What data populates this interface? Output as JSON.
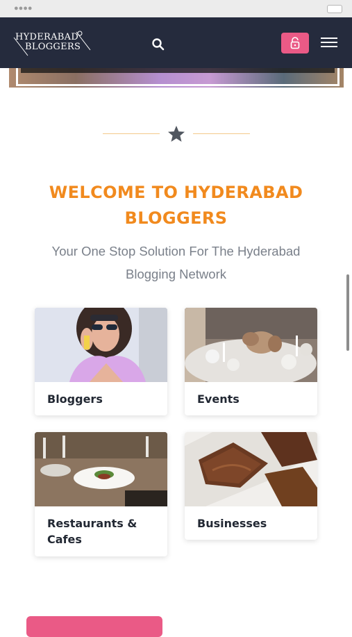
{
  "brand": {
    "logo_line1": "HYDERABAD",
    "logo_line2": "BLOGGERS",
    "accent": "#f18a1e",
    "pink": "#ea5a86",
    "navy": "#252b3d"
  },
  "header": {
    "search_icon": "search-icon",
    "login_icon": "lock-open-icon",
    "menu_icon": "hamburger-menu-icon"
  },
  "divider": {
    "icon": "star-icon"
  },
  "welcome": {
    "title": "WELCOME TO HYDERABAD BLOGGERS",
    "subtitle": "Your One Stop Solution For The Hyderabad Blogging Network"
  },
  "categories": [
    {
      "label": "Bloggers",
      "image": "woman-in-sunglasses-photo"
    },
    {
      "label": "Events",
      "image": "event-table-photo"
    },
    {
      "label": "Restaurants & Cafes",
      "image": "restaurant-dining-photo"
    },
    {
      "label": "Businesses",
      "image": "chocolate-brownies-photo"
    }
  ]
}
